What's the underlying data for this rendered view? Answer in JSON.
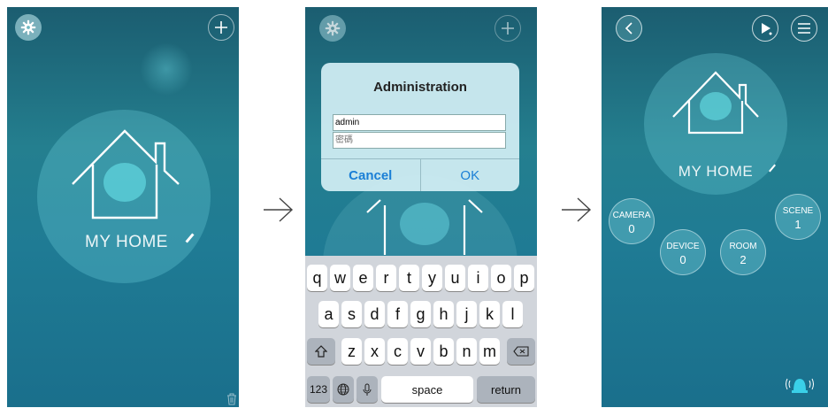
{
  "screen1": {
    "home_label": "MY HOME"
  },
  "screen2": {
    "dialog": {
      "title": "Administration",
      "username_value": "admin",
      "password_placeholder": "密碼",
      "cancel_label": "Cancel",
      "ok_label": "OK"
    },
    "keyboard": {
      "row1": [
        "q",
        "w",
        "e",
        "r",
        "t",
        "y",
        "u",
        "i",
        "o",
        "p"
      ],
      "row2": [
        "a",
        "s",
        "d",
        "f",
        "g",
        "h",
        "j",
        "k",
        "l"
      ],
      "row3": [
        "z",
        "x",
        "c",
        "v",
        "b",
        "n",
        "m"
      ],
      "numbers_label": "123",
      "space_label": "space",
      "return_label": "return"
    }
  },
  "screen3": {
    "home_label": "MY HOME",
    "stats": {
      "camera": {
        "label": "CAMERA",
        "value": "0"
      },
      "scene": {
        "label": "SCENE",
        "value": "1"
      },
      "device": {
        "label": "DEVICE",
        "value": "0"
      },
      "room": {
        "label": "ROOM",
        "value": "2"
      }
    }
  },
  "colors": {
    "background_top": "#1b5d70",
    "background_bottom": "#1a6f8c",
    "dialog_button": "#1a7fd6"
  }
}
